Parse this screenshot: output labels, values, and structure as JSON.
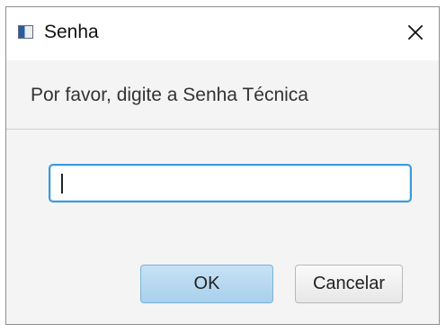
{
  "window": {
    "title": "Senha",
    "close_symbol": "×"
  },
  "dialog": {
    "prompt": "Por favor, digite a Senha Técnica",
    "password_value": "",
    "ok_label": "OK",
    "cancel_label": "Cancelar"
  },
  "icons": {
    "app": "window-app-icon",
    "close": "close-icon"
  },
  "colors": {
    "focus_border": "#3f9ad8",
    "ok_button": "#b8d9f0",
    "dialog_background": "#f4f4f4"
  }
}
